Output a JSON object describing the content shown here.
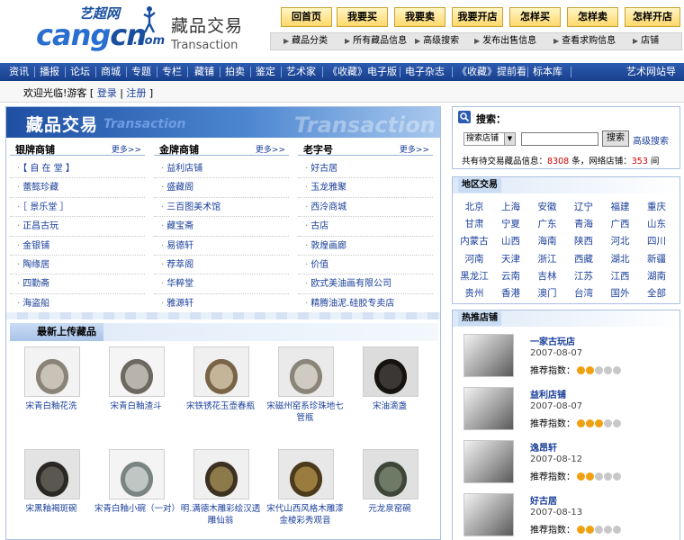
{
  "header": {
    "logo_top": "艺超网",
    "logo_main_a": "cang",
    "logo_main_b": "cn",
    "logo_domain": ".com",
    "brand_zh": "藏品交易",
    "brand_en": "Transaction"
  },
  "top_buttons": [
    "回首页",
    "我要买",
    "我要卖",
    "我要开店",
    "怎样买",
    "怎样卖",
    "怎样开店"
  ],
  "sub_links": [
    "藏品分类",
    "所有藏品信息",
    "高级搜索",
    "发布出售信息",
    "查看求购信息",
    "店铺"
  ],
  "nav": [
    "资讯",
    "播报",
    "论坛",
    "商城",
    "专题",
    "专栏",
    "藏铺",
    "拍卖",
    "鉴定",
    "艺术家",
    "《收藏》电子版",
    "电子杂志",
    "《收藏》提前看",
    "标本库",
    "艺术网站导"
  ],
  "welcome": {
    "prefix": "欢迎光临!游客 [ ",
    "login": "登录",
    "sep": " | ",
    "register": "注册",
    "suffix": " ]"
  },
  "banner": {
    "zh": "藏品交易",
    "en": "Transaction",
    "watermark": "Transaction"
  },
  "columns": [
    {
      "title": "银牌商铺",
      "more": "更多>>",
      "items": [
        "【 自 在 堂 】",
        "蕾懿珍藏",
        "［ 景乐堂 ］",
        "正昌古玩",
        "金银铺",
        "陶缘居",
        "四勤斋",
        "海盗船"
      ]
    },
    {
      "title": "金牌商铺",
      "more": "更多>>",
      "items": [
        "益利店铺",
        "盛藏阁",
        "三百图美术馆",
        "藏宝斋",
        "易德轩",
        "荐萃阁",
        "华粹堂",
        "雅源轩"
      ]
    },
    {
      "title": "老字号",
      "more": "更多>>",
      "items": [
        "好古居",
        "玉龙雅聚",
        "西泠商城",
        "古店",
        "敦煌画廊",
        "价值",
        "欧式美油画有限公司",
        "精腾油泥.硅胶专卖店"
      ]
    }
  ],
  "new_items": {
    "title": "最新上传藏品",
    "items": [
      {
        "caption": "宋青白釉花洗",
        "palette": [
          "#f3f3f3",
          "#c9c2b6",
          "#8a8378"
        ]
      },
      {
        "caption": "宋青白釉渣斗",
        "palette": [
          "#f5f5f5",
          "#b9b4ab",
          "#6d6860"
        ]
      },
      {
        "caption": "宋铁锈花玉壶春瓶",
        "palette": [
          "#f0f0f0",
          "#c4b49a",
          "#7a6448"
        ]
      },
      {
        "caption": "宋磁州窑系珍珠地七管瓶",
        "palette": [
          "#eaeaea",
          "#cfcbc2",
          "#8b8579"
        ]
      },
      {
        "caption": "宋油滴盏",
        "palette": [
          "#dcdcdc",
          "#3a3734",
          "#15130f"
        ]
      },
      {
        "caption": "宋黑釉褐斑碗",
        "palette": [
          "#e3e3e3",
          "#5a5650",
          "#2a2824"
        ]
      },
      {
        "caption": "宋青白釉小碗（一对）",
        "palette": [
          "#f4f4f4",
          "#bfc6c4",
          "#7a8482"
        ]
      },
      {
        "caption": "明.满德木雕彩绘汉透雕仙翁",
        "palette": [
          "#f0f0f0",
          "#8d7a4b",
          "#3d3222"
        ]
      },
      {
        "caption": "宋代山西风格木雕漆金棱彩秀观音",
        "palette": [
          "#e8e8e8",
          "#9a7d3e",
          "#4b3a1c"
        ]
      },
      {
        "caption": "元龙泉窑碗",
        "palette": [
          "#e0e0e0",
          "#6e7a66",
          "#3d4638"
        ]
      }
    ]
  },
  "search": {
    "label": "搜索：",
    "select": "搜索店铺",
    "button": "搜索",
    "advanced": "高级搜索",
    "stat_a": "共有待交易藏品信息：",
    "stat_n1": "8308",
    "stat_b": " 条，网络店铺：",
    "stat_n2": "353",
    "stat_c": " 间"
  },
  "regions": {
    "title": "地区交易",
    "items": [
      "北京",
      "上海",
      "安徽",
      "辽宁",
      "福建",
      "重庆",
      "甘肃",
      "宁夏",
      "广东",
      "青海",
      "广西",
      "山东",
      "内蒙古",
      "山西",
      "海南",
      "陕西",
      "河北",
      "四川",
      "河南",
      "天津",
      "浙江",
      "西藏",
      "湖北",
      "新疆",
      "黑龙江",
      "云南",
      "吉林",
      "江苏",
      "江西",
      "湖南",
      "贵州",
      "香港",
      "澳门",
      "台湾",
      "国外",
      "全部"
    ]
  },
  "hot_shops": {
    "title": "热推店铺",
    "rec_label": "推荐指数：",
    "items": [
      {
        "name": "一家古玩店",
        "date": "2007-08-07",
        "stars": 2
      },
      {
        "name": "益利店铺",
        "date": "2007-08-07",
        "stars": 3
      },
      {
        "name": "逸昂轩",
        "date": "2007-08-12",
        "stars": 2
      },
      {
        "name": "好古居",
        "date": "2007-08-13",
        "stars": 2
      }
    ]
  },
  "colors": {
    "nav_bg": "#1f4a9a",
    "link": "#1a3f9a",
    "accent_red": "#d40000",
    "button_gold": "#ffd86b",
    "star": "#f0a010"
  }
}
